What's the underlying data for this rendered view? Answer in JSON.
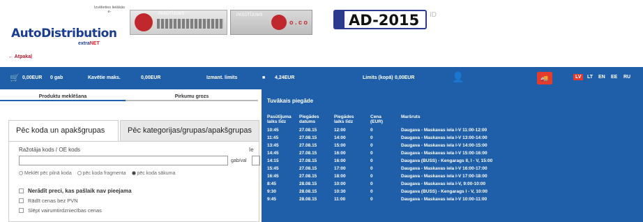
{
  "header": {
    "logo": "AutoDistribution",
    "logo_sub_prefix": "extra",
    "logo_sub_suffix": "NET",
    "back_link": "← Atpakaļ",
    "partner_note": "Izvēlieties lielākās e-",
    "banner_1_caption": "PASŪTĪJUMS",
    "banner_2_caption": "PASŪTĪJUMS",
    "banner_2_tail": "o . c o",
    "plate_text": "AD-2015",
    "plate_icon": "ID"
  },
  "toolbar": {
    "cart_icon": "cart-icon",
    "cart_total": "0,00EUR",
    "cart_count": "0 gab",
    "debt_label": "Kavētie maks.",
    "debt_value": "0,00EUR",
    "limit_label": "Izmant. limits",
    "limit_value": "4,24EUR",
    "total_limit_label": "Limits (kopā)",
    "total_limit_value": "0,00EUR",
    "languages": [
      "LV",
      "LT",
      "EN",
      "EE",
      "RU"
    ],
    "active_language": "LV"
  },
  "left": {
    "tab_products": "Produktu meklēšana",
    "tab_cart": "Pirkumu grozs",
    "search_tab_1": "Pēc koda un apakšgrupas",
    "search_tab_2": "Pēc kategorijas/grupas/apakšgrupas",
    "code_label": "Ražotāja kods / OE kods",
    "side_label": "Ie",
    "unit_label": "gab/val",
    "radio_1": "Meklēt pēc pilnā koda",
    "radio_2": "pēc koda fragmenta",
    "radio_3": "pēc koda sākuma",
    "chk_1": "Nerādīt preci, kas pašlaik nav pieejama",
    "chk_2": "Rādīt cenas bez PVN",
    "chk_3": "Slēpt vairumtirdzniecības cenas"
  },
  "panel": {
    "title": "Tuvākais piegāde",
    "columns": [
      "Pasūtījuma laiks līdz",
      "Piegādes datums",
      "Piegādes laiks līdz",
      "Cena (EUR)",
      "Maršruts"
    ],
    "rows": [
      [
        "10:45",
        "27.08.15",
        "12:00",
        "0",
        "Daugava - Maskavas iela I-V 11:00-12:00"
      ],
      [
        "11:45",
        "27.08.15",
        "14:00",
        "0",
        "Daugava - Maskavas iela I-V 13:00-14:00"
      ],
      [
        "13:45",
        "27.08.15",
        "15:00",
        "0",
        "Daugava - Maskavas iela I-V 14:00-15:00"
      ],
      [
        "14:45",
        "27.08.15",
        "16:00",
        "0",
        "Daugava - Maskavas iela I-V 15:00-16:00"
      ],
      [
        "14:15",
        "27.08.15",
        "16:00",
        "0",
        "Daugava (BUSS) - Kengarags II, I - V, 15:00"
      ],
      [
        "15:45",
        "27.08.15",
        "17:00",
        "0",
        "Daugava - Maskavas iela I-V 16:00-17:00"
      ],
      [
        "16:45",
        "27.08.15",
        "18:00",
        "0",
        "Daugava - Maskavas iela I-V 17:00-18:00"
      ],
      [
        "8:45",
        "28.08.15",
        "10:00",
        "0",
        "Daugava - Maskavas iela I-V, 9:00-10:00"
      ],
      [
        "9:30",
        "28.08.15",
        "10:30",
        "0",
        "Daugava (BUSS) - Kengarags I - V, 10:00"
      ],
      [
        "9:45",
        "28.08.15",
        "11:00",
        "0",
        "Daugava - Maskavas iela I-V 10:00-11:00"
      ]
    ]
  }
}
